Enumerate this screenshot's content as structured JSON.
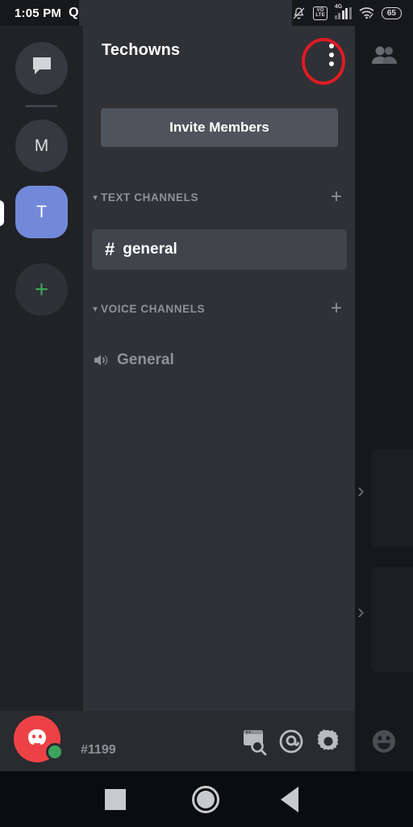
{
  "status_bar": {
    "time": "1:05 PM",
    "app_badge": "Q",
    "icons": [
      "bell-muted-icon",
      "volte-icon",
      "signal-4g-icon",
      "wifi-icon",
      "battery-icon"
    ],
    "volte_top": "VO",
    "volte_bottom": "LTE",
    "network_type": "4G",
    "battery_level": "65"
  },
  "server_rail": {
    "items": [
      {
        "name": "direct-messages",
        "label": "",
        "icon": "chat-bubble-icon",
        "selected": false
      },
      {
        "name": "server-m",
        "label": "M",
        "icon": "",
        "selected": false
      },
      {
        "name": "server-t",
        "label": "T",
        "icon": "",
        "selected": true
      },
      {
        "name": "add-server",
        "label": "+",
        "icon": "plus-icon",
        "selected": false
      }
    ],
    "selected_color": "#7289da",
    "add_color": "#3ba55d"
  },
  "sidebar": {
    "guild_name": "Techowns",
    "overflow_label": "more-options",
    "invite_label": "Invite Members",
    "sections": [
      {
        "label": "TEXT CHANNELS",
        "collapse_icon": "chevron-down-icon",
        "add_icon": "plus-icon"
      },
      {
        "label": "VOICE CHANNELS",
        "collapse_icon": "chevron-down-icon",
        "add_icon": "plus-icon"
      }
    ],
    "text_channels": [
      {
        "prefix": "#",
        "name": "general",
        "selected": true
      }
    ],
    "voice_channels": [
      {
        "icon": "speaker-icon",
        "name": "General",
        "selected": false
      }
    ],
    "annotation": {
      "shape": "ellipse",
      "color": "#e01b24",
      "target": "overflow-menu-button"
    }
  },
  "chat_panel": {
    "members_icon": "members-icon",
    "expand_icons": [
      "chevron-right-icon",
      "chevron-right-icon"
    ]
  },
  "bottom_bar": {
    "avatar_icon": "discord-logo-icon",
    "avatar_color": "#ed4245",
    "status": "online",
    "status_color": "#3ba55d",
    "discriminator": "#1199",
    "actions": [
      {
        "name": "search-button",
        "icon": "browser-search-icon"
      },
      {
        "name": "mentions-button",
        "icon": "at-sign-icon"
      },
      {
        "name": "settings-button",
        "icon": "gear-icon"
      },
      {
        "name": "emoji-button",
        "icon": "smiley-icon"
      }
    ]
  },
  "nav_bar": {
    "buttons": [
      {
        "name": "recents-button",
        "icon": "square-icon"
      },
      {
        "name": "home-button",
        "icon": "circle-icon"
      },
      {
        "name": "back-button",
        "icon": "triangle-left-icon"
      }
    ]
  }
}
